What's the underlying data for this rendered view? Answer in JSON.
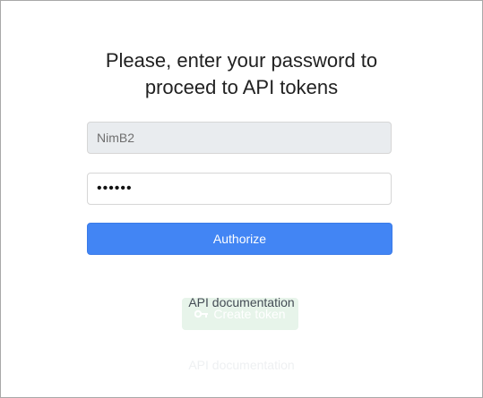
{
  "auth": {
    "title_line1": "Please, enter your password to",
    "title_line2": "proceed to API tokens",
    "login_value": "NimB2",
    "password_value": "secret",
    "authorize_label": "Authorize"
  },
  "background": {
    "create_token_label": "Create token",
    "docs_label": "API documentation"
  },
  "links": {
    "api_docs_label": "API documentation"
  },
  "colors": {
    "accent": "#4285f4",
    "ghost_green": "#e7f4ea",
    "border": "#a8a8a8"
  },
  "icons": {
    "create_token": "key-icon"
  }
}
